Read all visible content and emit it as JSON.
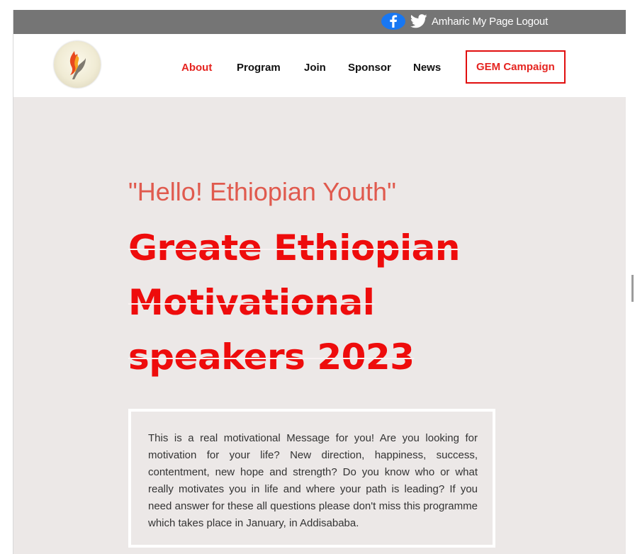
{
  "topbar": {
    "icons": [
      "facebook-icon",
      "twitter-icon"
    ],
    "links": [
      "Amharic",
      "My Page",
      "Logout"
    ]
  },
  "nav": {
    "logo": "flame-hand-logo",
    "items": [
      "About",
      "Program",
      "Join",
      "Sponsor",
      "News"
    ],
    "active_item": "About",
    "campaign": "GEM Campaign"
  },
  "hero": {
    "greeting": "\"Hello! Ethiopian Youth\"",
    "headline": "Greate Ethiopian Motivational speakers 2023"
  },
  "message": {
    "text": "This is a real motivational Message for you! Are you looking for motivation for your life? New direction, happiness, success, contentment, new hope and strength? Do you know who or what really motivates you in life and where your path is leading? If you need answer for these all questions please don't miss this programme which takes place in January, in Addisababa."
  },
  "colors": {
    "topbar": "#757575",
    "accent_red": "#e52420",
    "greeting": "#e05a4e",
    "background": "#ece8e7",
    "facebook": "#1877f2"
  }
}
